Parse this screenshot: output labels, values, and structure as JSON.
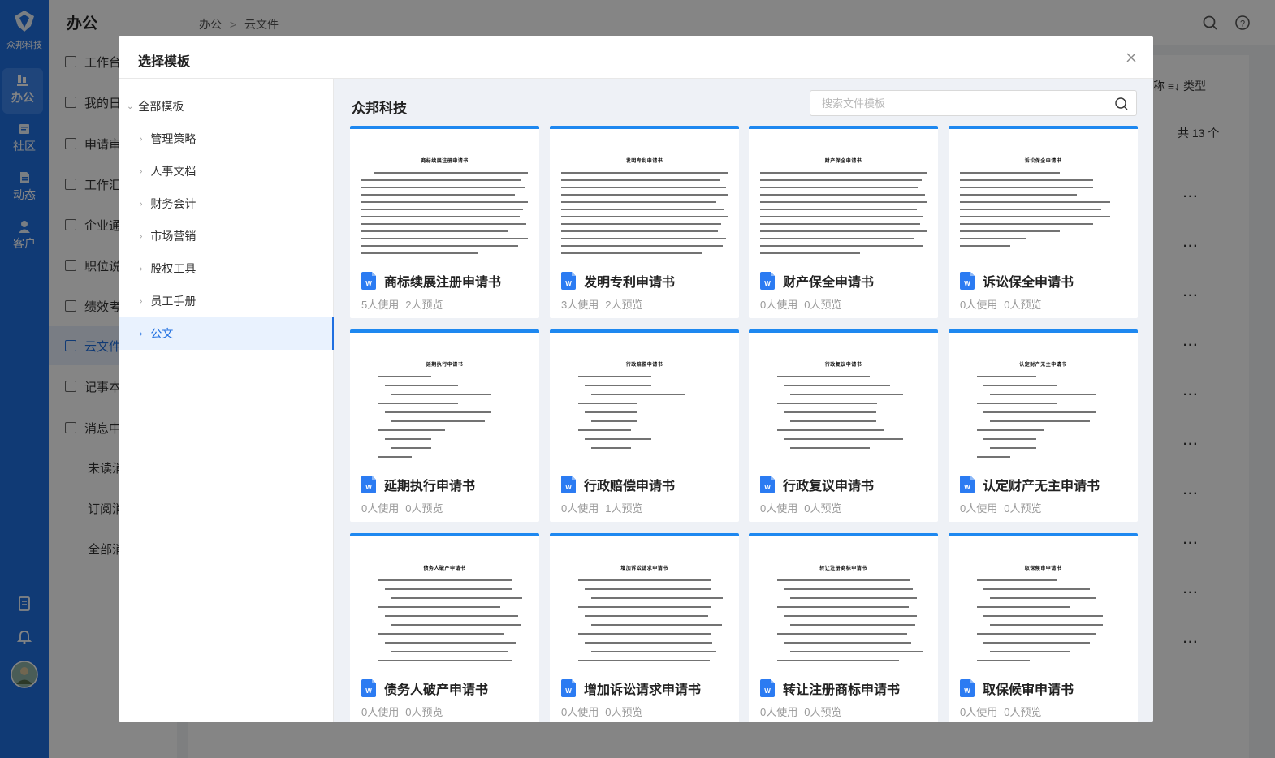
{
  "app": {
    "logo_text": "众邦科技",
    "rail_items": [
      {
        "label": "办公",
        "icon": "office-icon"
      },
      {
        "label": "社区",
        "icon": "community-icon"
      },
      {
        "label": "动态",
        "icon": "feed-icon"
      },
      {
        "label": "客户",
        "icon": "customer-icon"
      }
    ]
  },
  "subnav": {
    "title": "办公",
    "items": [
      {
        "label": "工作台"
      },
      {
        "label": "我的日"
      },
      {
        "label": "申请审"
      },
      {
        "label": "工作汇"
      },
      {
        "label": "企业通"
      },
      {
        "label": "职位说"
      },
      {
        "label": "绩效考"
      },
      {
        "label": "云文件"
      },
      {
        "label": "记事本"
      },
      {
        "label": "消息中"
      },
      {
        "label": "未读消"
      },
      {
        "label": "订阅消"
      },
      {
        "label": "全部消"
      }
    ]
  },
  "breadcrumb": {
    "root": "办公",
    "sep": ">",
    "current": "云文件"
  },
  "background": {
    "tools": "称 ≡↓ 类型",
    "count": "共 13 个",
    "more": "···"
  },
  "modal": {
    "title": "选择模板",
    "tree": {
      "root": "全部模板",
      "nodes": [
        {
          "label": "管理策略",
          "active": false
        },
        {
          "label": "人事文档",
          "active": false
        },
        {
          "label": "财务会计",
          "active": false
        },
        {
          "label": "市场营销",
          "active": false
        },
        {
          "label": "股权工具",
          "active": false
        },
        {
          "label": "员工手册",
          "active": false
        },
        {
          "label": "公文",
          "active": true
        }
      ]
    },
    "content_title": "众邦科技",
    "search": {
      "placeholder": "搜索文件模板",
      "value": ""
    },
    "accent": "#1e88f0",
    "cards": [
      {
        "name": "商标续展注册申请书",
        "used": "5人使用",
        "preview": "2人预览",
        "doc_title": "商标续展注册申请书"
      },
      {
        "name": "发明专利申请书",
        "used": "3人使用",
        "preview": "2人预览",
        "doc_title": "发明专利申请书"
      },
      {
        "name": "财产保全申请书",
        "used": "0人使用",
        "preview": "0人预览",
        "doc_title": "财产保全申请书"
      },
      {
        "name": "诉讼保全申请书",
        "used": "0人使用",
        "preview": "0人预览",
        "doc_title": "诉讼保全申请书"
      },
      {
        "name": "延期执行申请书",
        "used": "0人使用",
        "preview": "0人预览",
        "doc_title": "延期执行申请书"
      },
      {
        "name": "行政赔偿申请书",
        "used": "0人使用",
        "preview": "1人预览",
        "doc_title": "行政赔偿申请书"
      },
      {
        "name": "行政复议申请书",
        "used": "0人使用",
        "preview": "0人预览",
        "doc_title": "行政复议申请书"
      },
      {
        "name": "认定财产无主申请书",
        "used": "0人使用",
        "preview": "0人预览",
        "doc_title": "认定财产无主申请书"
      },
      {
        "name": "债务人破产申请书",
        "used": "0人使用",
        "preview": "0人预览",
        "doc_title": "债务人破产申请书"
      },
      {
        "name": "增加诉讼请求申请书",
        "used": "0人使用",
        "preview": "0人预览",
        "doc_title": "增加诉讼请求申请书"
      },
      {
        "name": "转让注册商标申请书",
        "used": "0人使用",
        "preview": "0人预览",
        "doc_title": "转让注册商标申请书"
      },
      {
        "name": "取保候审申请书",
        "used": "0人使用",
        "preview": "0人预览",
        "doc_title": "取保候审申请书"
      }
    ]
  }
}
